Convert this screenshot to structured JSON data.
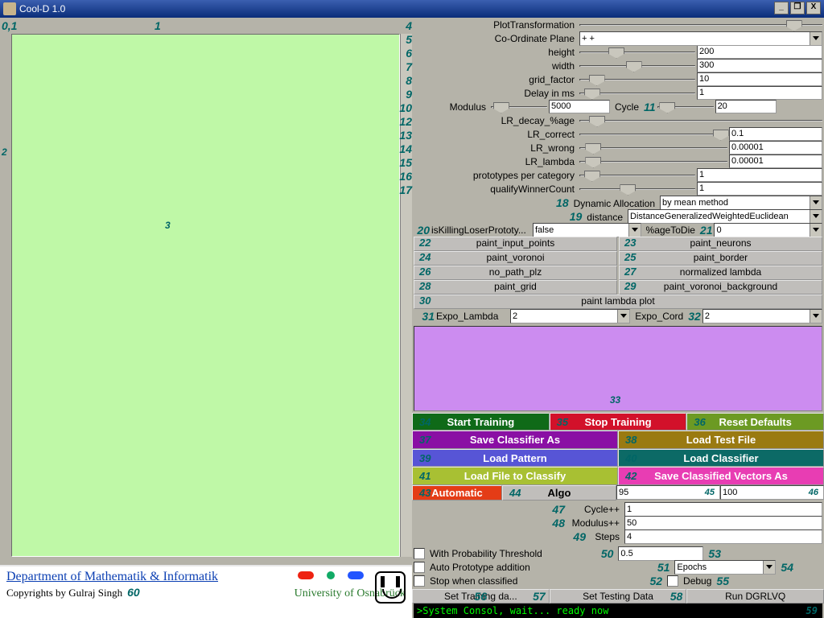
{
  "window": {
    "title": "Cool-D 1.0",
    "min_icon": "_",
    "max_icon": "❐",
    "close_icon": "X"
  },
  "nums": {
    "n01": "0,1",
    "n1": "1",
    "n2": "2",
    "n3": "3"
  },
  "params": {
    "plotTransformation": {
      "num": "4",
      "label": "PlotTransformation",
      "thumb": 85
    },
    "coOrdinate": {
      "num": "5",
      "label": "Co-Ordinate Plane",
      "value": "+ +"
    },
    "height": {
      "num": "6",
      "label": "height",
      "thumb": 25,
      "value": "200"
    },
    "width": {
      "num": "7",
      "label": "width",
      "thumb": 40,
      "value": "300"
    },
    "grid_factor": {
      "num": "8",
      "label": "grid_factor",
      "thumb": 8,
      "value": "10"
    },
    "delay": {
      "num": "9",
      "label": "Delay in ms",
      "thumb": 4,
      "value": "1"
    },
    "modulus": {
      "num": "10",
      "label": "Modulus",
      "thumb": 4,
      "midval": "5000",
      "rightlabelnum": "11",
      "rightlabel": "Cycle",
      "thumb2": 4,
      "value2": "20"
    },
    "lr_decay": {
      "num": "12",
      "label": "LR_decay_%age",
      "thumb": 4
    },
    "lr_correct": {
      "num": "13",
      "label": "LR_correct",
      "value": "0.1"
    },
    "lr_wrong": {
      "num": "14",
      "label": "LR_wrong",
      "value": "0.00001"
    },
    "lr_lambda": {
      "num": "15",
      "label": "LR_lambda",
      "value": "0.00001"
    },
    "protos": {
      "num": "16",
      "label": "prototypes per category",
      "thumb": 4,
      "value": "1"
    },
    "qualify": {
      "num": "17",
      "label": "qualifyWinnerCount",
      "thumb": 35,
      "value": "1"
    },
    "dyn": {
      "num": "18",
      "label": "Dynamic Allocation",
      "value": "by mean method"
    },
    "distance": {
      "num": "19",
      "label": "distance",
      "value": "DistanceGeneralizedWeightedEuclidean"
    },
    "isKill": {
      "num": "20",
      "label": "isKillingLoserPrototy...",
      "value": "false"
    },
    "ageToDie": {
      "num": "21",
      "label": "%ageToDie",
      "value": "0"
    },
    "paint_input": {
      "num": "22",
      "label": "paint_input_points"
    },
    "paint_neurons": {
      "num": "23",
      "label": "paint_neurons"
    },
    "paint_voronoi": {
      "num": "24",
      "label": "paint_voronoi"
    },
    "paint_border": {
      "num": "25",
      "label": "paint_border"
    },
    "no_path": {
      "num": "26",
      "label": "no_path_plz"
    },
    "norm_lambda": {
      "num": "27",
      "label": "normalized lambda"
    },
    "paint_grid": {
      "num": "28",
      "label": "paint_grid"
    },
    "paint_vbg": {
      "num": "29",
      "label": "paint_voronoi_background"
    },
    "paint_lambda": {
      "num": "30",
      "label": "paint lambda plot"
    },
    "expo_lambda": {
      "num": "31",
      "label": "Expo_Lambda",
      "value": "2"
    },
    "expo_cord": {
      "num": "32",
      "label": "Expo_Cord",
      "value": "2"
    },
    "viz_num": "33"
  },
  "buttons": {
    "start": {
      "num": "34",
      "label": "Start Training",
      "bg": "#0f6a18"
    },
    "stop": {
      "num": "35",
      "label": "Stop Training",
      "bg": "#d2112a"
    },
    "reset": {
      "num": "36",
      "label": "Reset Defaults",
      "bg": "#6c9a23"
    },
    "saveClass": {
      "num": "37",
      "label": "Save Classifier As",
      "bg": "#8a0fa4"
    },
    "loadTest": {
      "num": "38",
      "label": "Load Test File",
      "bg": "#9a7a11"
    },
    "loadPattern": {
      "num": "39",
      "label": "Load Pattern",
      "bg": "#5755d6"
    },
    "loadClassifier": {
      "num": "40",
      "label": "Load Classifier",
      "bg": "#0c6a66"
    },
    "loadFile": {
      "num": "41",
      "label": "Load File to Classify",
      "bg": "#a8c033"
    },
    "saveVectors": {
      "num": "42",
      "label": "Save Classified Vectors As",
      "bg": "#e83db3"
    },
    "automatic": {
      "num": "43",
      "label": "Automatic",
      "bg": "#e43c16"
    },
    "algo": {
      "num": "44",
      "label": "Algo",
      "bg": "#c0bebb"
    }
  },
  "algo": {
    "v1": "95",
    "num1": "45",
    "v2": "100",
    "num2": "46"
  },
  "train": {
    "cyclepp": {
      "num": "47",
      "label": "Cycle++",
      "value": "1"
    },
    "moduluspp": {
      "num": "48",
      "label": "Modulus++",
      "value": "50"
    },
    "steps": {
      "num": "49",
      "label": "Steps",
      "value": "4"
    }
  },
  "checks": {
    "prob": {
      "num": "50",
      "label": "With Probability Threshold"
    },
    "auto": {
      "num": "51",
      "label": "Auto Prototype addition"
    },
    "stop": {
      "num": "52",
      "label": "Stop when classified"
    },
    "probval": "0.5",
    "probnum": "53",
    "epochs": "Epochs",
    "epochnum": "54",
    "debug": "Debug",
    "debugnum": "55"
  },
  "setrow": {
    "setTrain": {
      "num": "56",
      "label": "Set Training da...",
      "rnum": "57"
    },
    "setTest": {
      "label": "Set Testing Data",
      "rnum": "58"
    },
    "run": {
      "label": "Run DGRLVQ"
    }
  },
  "console": {
    "text": ">System Consol, wait... ready now",
    "num": "59"
  },
  "footer": {
    "dept": "Department of Mathematik & Informatik",
    "cop": "Copyrights by Gulraj Singh",
    "copnum": "60",
    "uni": "University of Osnabrück"
  }
}
